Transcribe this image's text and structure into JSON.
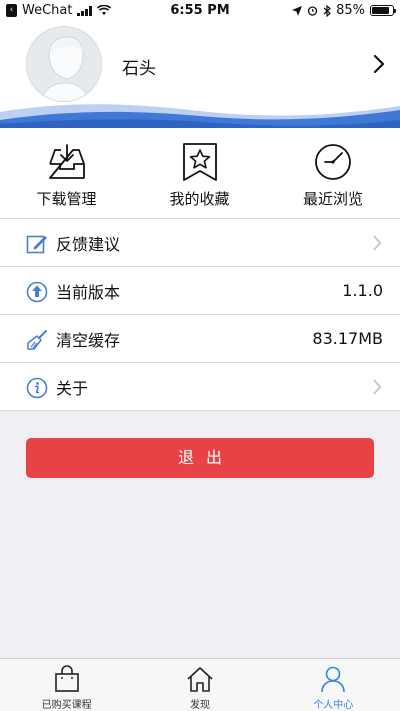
{
  "status_bar": {
    "back_icon": "back-to-app-icon",
    "carrier": "WeChat",
    "time": "6:55 PM",
    "battery": "85%",
    "battery_level": 0.85
  },
  "profile": {
    "username": "石头"
  },
  "quick_actions": [
    {
      "label": "下载管理",
      "icon": "download-tray-icon"
    },
    {
      "label": "我的收藏",
      "icon": "star-bookmark-icon"
    },
    {
      "label": "最近浏览",
      "icon": "clock-icon"
    }
  ],
  "settings": {
    "feedback": {
      "label": "反馈建议",
      "icon": "edit-icon"
    },
    "version": {
      "label": "当前版本",
      "value": "1.1.0",
      "icon": "upload-arrow-icon"
    },
    "cache": {
      "label": "清空缓存",
      "value": "83.17MB",
      "icon": "broom-icon"
    },
    "about": {
      "label": "关于",
      "icon": "info-icon"
    }
  },
  "logout": {
    "label": "退出"
  },
  "tabbar": {
    "tabs": [
      {
        "label": "已购买课程",
        "icon": "shopping-bag-icon",
        "active": false
      },
      {
        "label": "发现",
        "icon": "home-icon",
        "active": false
      },
      {
        "label": "个人中心",
        "icon": "person-icon",
        "active": true
      }
    ]
  },
  "colors": {
    "accent_blue": "#2e84e6",
    "logout_red": "#e74245",
    "wave_blue": "#3f78d6",
    "icon_blue": "#4a7fd0"
  }
}
